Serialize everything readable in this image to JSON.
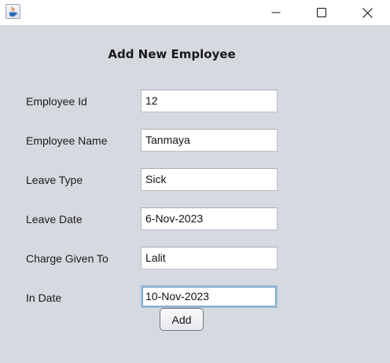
{
  "window": {
    "icon": "java-icon",
    "controls": {
      "minimize": "minimize-icon",
      "maximize": "maximize-icon",
      "close": "close-icon"
    }
  },
  "form": {
    "heading": "Add New Employee",
    "fields": [
      {
        "label": "Employee Id",
        "value": "12"
      },
      {
        "label": "Employee Name",
        "value": "Tanmaya"
      },
      {
        "label": "Leave Type",
        "value": "Sick"
      },
      {
        "label": "Leave Date",
        "value": "6-Nov-2023"
      },
      {
        "label": "Charge Given To",
        "value": "Lalit"
      },
      {
        "label": "In Date",
        "value": "10-Nov-2023",
        "focused": true
      }
    ],
    "submit_label": "Add"
  },
  "colors": {
    "background": "#d6d9df",
    "titlebar": "#ffffff",
    "focus_border": "#7a9cc4"
  }
}
